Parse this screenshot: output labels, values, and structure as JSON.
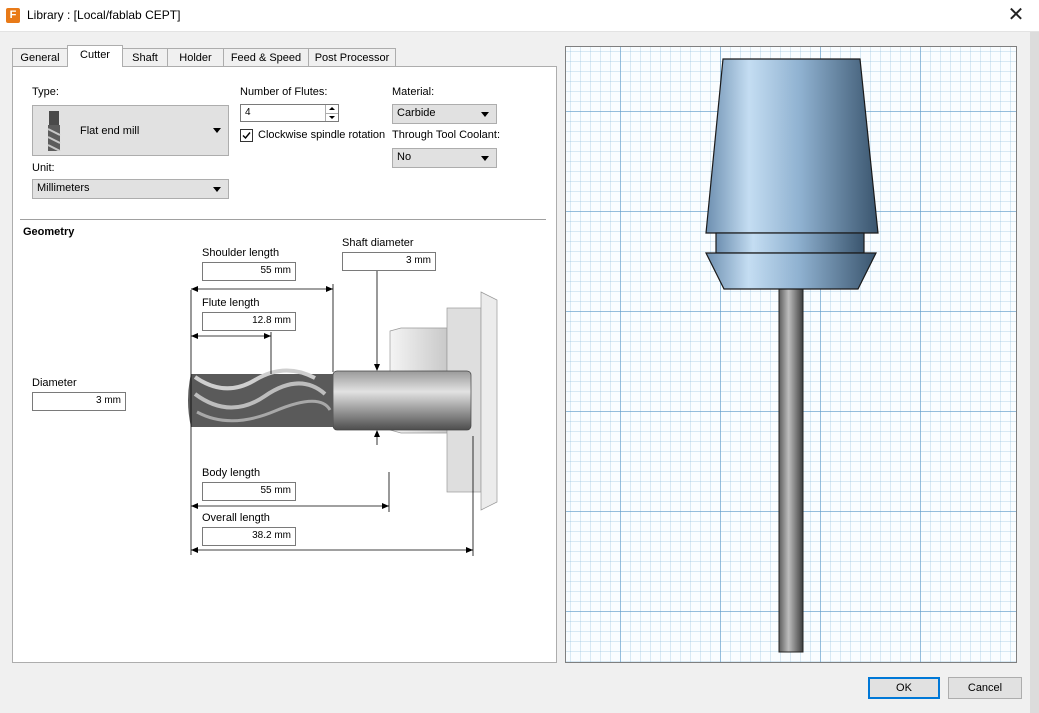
{
  "window": {
    "app_icon": "F",
    "title": "Library : [Local/fablab CEPT]",
    "close_glyph": "✕"
  },
  "tabs": [
    "General",
    "Cutter",
    "Shaft",
    "Holder",
    "Feed & Speed",
    "Post Processor"
  ],
  "active_tab": "Cutter",
  "cutter": {
    "type_label": "Type:",
    "type_value": "Flat end mill",
    "unit_label": "Unit:",
    "unit_value": "Millimeters",
    "flutes_label": "Number of Flutes:",
    "flutes_value": "4",
    "clockwise_label": "Clockwise spindle rotation",
    "clockwise_checked": true,
    "material_label": "Material:",
    "material_value": "Carbide",
    "coolant_label": "Through Tool Coolant:",
    "coolant_value": "No"
  },
  "geometry": {
    "heading": "Geometry",
    "shoulder_length_label": "Shoulder length",
    "shoulder_length_value": "55 mm",
    "shaft_diameter_label": "Shaft diameter",
    "shaft_diameter_value": "3 mm",
    "flute_length_label": "Flute length",
    "flute_length_value": "12.8 mm",
    "diameter_label": "Diameter",
    "diameter_value": "3 mm",
    "body_length_label": "Body length",
    "body_length_value": "55 mm",
    "overall_length_label": "Overall length",
    "overall_length_value": "38.2 mm"
  },
  "buttons": {
    "ok": "OK",
    "cancel": "Cancel"
  },
  "colors": {
    "accent": "#0078d7",
    "holder_blue": "#8fb1d0",
    "app_icon": "#e87a18"
  },
  "icons": [
    "app-icon",
    "close-icon",
    "flat-end-mill-icon",
    "dropdown-arrow-icon",
    "spinner-up-icon",
    "spinner-down-icon",
    "checkbox-check-icon"
  ]
}
